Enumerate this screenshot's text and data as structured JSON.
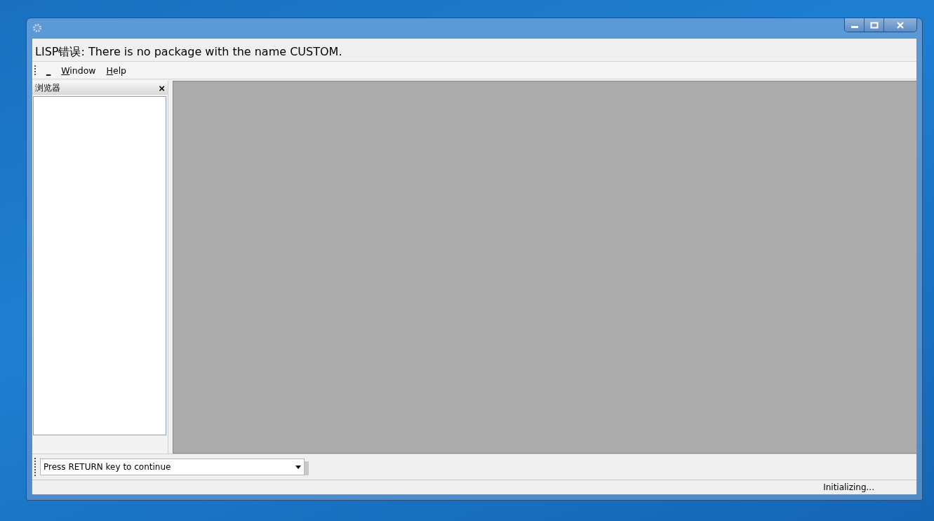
{
  "window": {
    "message": "LISP错误: There is no package with the name CUSTOM."
  },
  "menu": [
    {
      "label": "_"
    },
    {
      "label": "Window"
    },
    {
      "label": "Help"
    }
  ],
  "browser_panel": {
    "title": "浏览器",
    "close": "×"
  },
  "command_bar": {
    "value": "Press RETURN key to continue"
  },
  "status_bar": {
    "text": "Initializing..."
  }
}
